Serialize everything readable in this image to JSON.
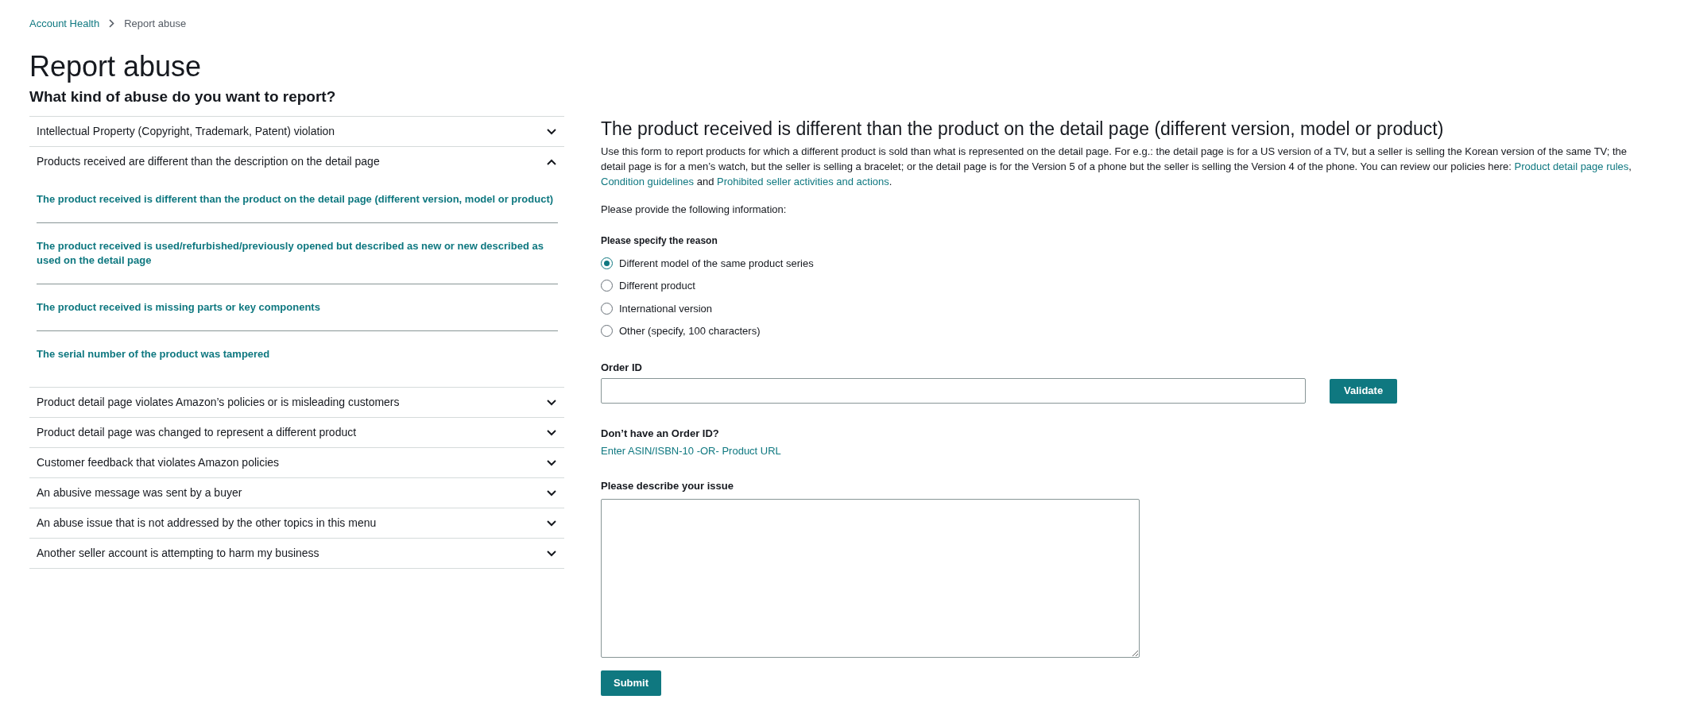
{
  "breadcrumb": [
    {
      "text": "Account Health",
      "kind": "link"
    },
    {
      "text": "Report abuse",
      "kind": "current"
    }
  ],
  "title": "Report abuse",
  "subtitle": "What kind of abuse do you want to report?",
  "categories": [
    {
      "label": "Intellectual Property (Copyright, Trademark, Patent) violation",
      "expanded": false
    },
    {
      "label": "Products received are different than the description on the detail page",
      "expanded": true,
      "children": [
        {
          "label": "The product received is different than the product on the detail page (different version, model or product)"
        },
        {
          "label": "The product received is used/refurbished/previously opened but described as new or new described as used on the detail page"
        },
        {
          "label": "The product received is missing parts or key components"
        },
        {
          "label": "The serial number of the product was tampered"
        }
      ]
    },
    {
      "label": "Product detail page violates Amazon’s policies or is misleading customers",
      "expanded": false
    },
    {
      "label": "Product detail page was changed to represent a different product",
      "expanded": false
    },
    {
      "label": "Customer feedback that violates Amazon policies",
      "expanded": false
    },
    {
      "label": "An abusive message was sent by a buyer",
      "expanded": false
    },
    {
      "label": "An abuse issue that is not addressed by the other topics in this menu",
      "expanded": false
    },
    {
      "label": "Another seller account is attempting to harm my business",
      "expanded": false
    }
  ],
  "form": {
    "heading": "The product received is different than the product on the detail page (different version, model or product)",
    "description": [
      {
        "kind": "text",
        "text": "Use this form to report products for which a different product is sold than what is represented on the detail page. For e.g.: the detail page is for a US version of a TV, but a seller is selling the Korean version of the same TV; the detail page is for a men’s watch, but the seller is selling a bracelet; or the detail page is for the Version 5 of a phone but the seller is selling the Version 4 of the phone. You can review our policies here: "
      },
      {
        "kind": "link",
        "text": "Product detail page rules"
      },
      {
        "kind": "text",
        "text": ", "
      },
      {
        "kind": "link",
        "text": "Condition guidelines"
      },
      {
        "kind": "text",
        "text": " and "
      },
      {
        "kind": "link",
        "text": "Prohibited seller activities and actions"
      },
      {
        "kind": "text",
        "text": "."
      }
    ],
    "instruction": "Please provide the following information:",
    "reason_label": "Please specify the reason",
    "reasons": [
      {
        "label": "Different model of the same product series",
        "selected": true
      },
      {
        "label": "Different product",
        "selected": false
      },
      {
        "label": "International version",
        "selected": false
      },
      {
        "label": "Other (specify, 100 characters)",
        "selected": false
      }
    ],
    "order_id_label": "Order ID",
    "validate_button": "Validate",
    "no_order_label": "Don’t have an Order ID?",
    "asin_link": "Enter ASIN/ISBN-10 -OR- Product URL",
    "describe_label": "Please describe your issue",
    "submit_button": "Submit"
  }
}
